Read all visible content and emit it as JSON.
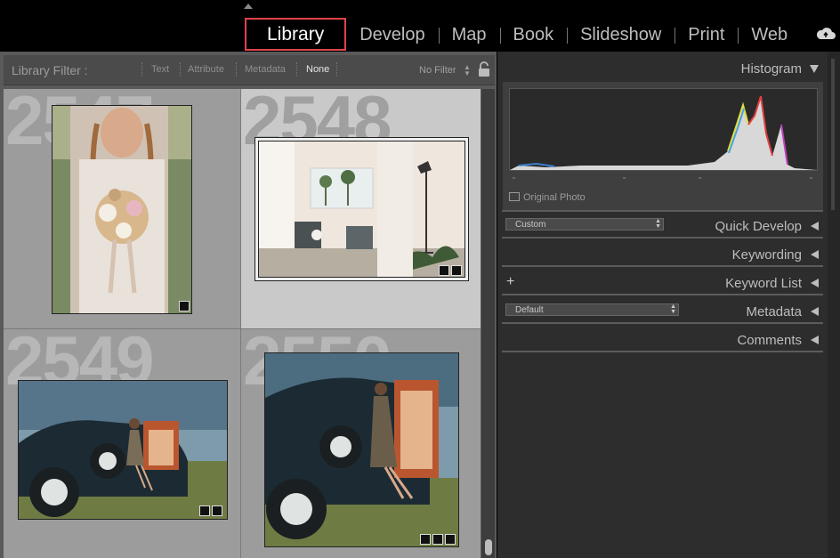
{
  "modules": [
    "Library",
    "Develop",
    "Map",
    "Book",
    "Slideshow",
    "Print",
    "Web"
  ],
  "active_module": "Library",
  "filter_bar": {
    "title": "Library Filter :",
    "options": [
      "Text",
      "Attribute",
      "Metadata",
      "None"
    ],
    "selected": "None",
    "preset": "No Filter"
  },
  "grid": {
    "cells": [
      {
        "number": "2547",
        "selected": false
      },
      {
        "number": "2548",
        "selected": true
      },
      {
        "number": "2549",
        "selected": false
      },
      {
        "number": "2550",
        "selected": false
      }
    ]
  },
  "right_panel": {
    "histogram": {
      "label": "Histogram",
      "original_photo_label": "Original Photo"
    },
    "quick_develop": {
      "label": "Quick Develop",
      "preset": "Custom"
    },
    "keywording": {
      "label": "Keywording"
    },
    "keyword_list": {
      "label": "Keyword List"
    },
    "metadata": {
      "label": "Metadata",
      "preset": "Default"
    },
    "comments": {
      "label": "Comments"
    }
  },
  "colors": {
    "active_module_border": "#e0434b",
    "panel_bg": "#2d2d2d",
    "grid_bg": "#9c9c9c"
  }
}
